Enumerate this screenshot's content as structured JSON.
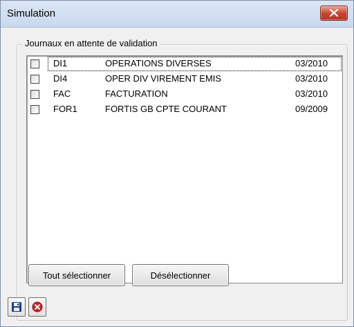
{
  "window": {
    "title": "Simulation"
  },
  "group": {
    "label": "Journaux en attente de validation"
  },
  "journals": [
    {
      "code": "DI1",
      "label": "OPERATIONS DIVERSES",
      "period": "03/2010",
      "checked": false
    },
    {
      "code": "DI4",
      "label": "OPER DIV VIREMENT EMIS",
      "period": "03/2010",
      "checked": false
    },
    {
      "code": "FAC",
      "label": "FACTURATION",
      "period": "03/2010",
      "checked": false
    },
    {
      "code": "FOR1",
      "label": "FORTIS GB CPTE COURANT",
      "period": "09/2009",
      "checked": false
    }
  ],
  "buttons": {
    "select_all": "Tout sélectionner",
    "deselect": "Désélectionner"
  },
  "toolbar": {
    "save_icon": "floppy-disk-icon",
    "cancel_icon": "red-x-circle-icon"
  },
  "colors": {
    "close_button": "#c7432b",
    "save_icon": "#1a3a8c",
    "cancel_icon": "#d32020"
  }
}
